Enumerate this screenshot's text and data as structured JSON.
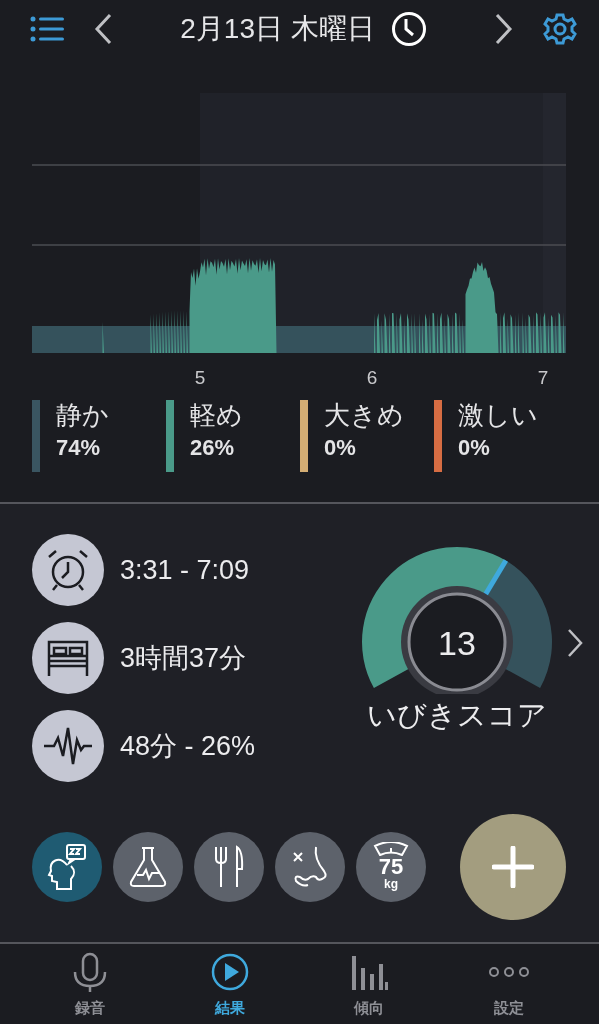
{
  "header": {
    "title": "2月13日 木曜日"
  },
  "chart": {
    "ticks": [
      "5",
      "6",
      "7"
    ]
  },
  "legend": [
    {
      "label": "静か",
      "percent": "74%",
      "color": "#3a5561"
    },
    {
      "label": "軽め",
      "percent": "26%",
      "color": "#4a9a89"
    },
    {
      "label": "大きめ",
      "percent": "0%",
      "color": "#d4ad74"
    },
    {
      "label": "激しい",
      "percent": "0%",
      "color": "#d76d43"
    }
  ],
  "stats": [
    {
      "kind": "alarm",
      "text": "3:31 - 7:09"
    },
    {
      "kind": "bed",
      "text": "3時間37分"
    },
    {
      "kind": "wave",
      "text": "48分 - 26%"
    }
  ],
  "score": {
    "value": "13",
    "label": "いびきスコア"
  },
  "factors": [
    {
      "kind": "sleep",
      "selected": true
    },
    {
      "kind": "flask",
      "selected": false
    },
    {
      "kind": "food",
      "selected": false
    },
    {
      "kind": "nose",
      "selected": false
    },
    {
      "kind": "weight",
      "selected": false,
      "value": "75",
      "unit": "kg"
    }
  ],
  "tabs": [
    {
      "kind": "mic",
      "label": "録音",
      "selected": false
    },
    {
      "kind": "play",
      "label": "結果",
      "selected": true
    },
    {
      "kind": "bars",
      "label": "傾向",
      "selected": false
    },
    {
      "kind": "dots",
      "label": "設定",
      "selected": false
    }
  ]
}
